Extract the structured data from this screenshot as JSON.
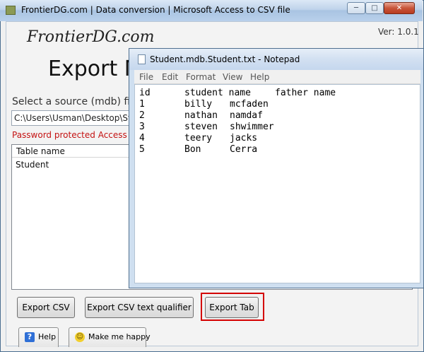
{
  "main_window": {
    "title": "FrontierDG.com | Data conversion | Microsoft Access to CSV file",
    "controls": {
      "minimize": "─",
      "maximize": "□",
      "close": "✕"
    }
  },
  "app": {
    "brand": "FrontierDG.com",
    "version": "Ver: 1.0.1",
    "heading": "Export M",
    "source_label": "Select a source (mdb) file",
    "source_path": "C:\\Users\\Usman\\Desktop\\St",
    "password_note": "Password protected Access da",
    "tables": {
      "header": "Table name",
      "rows": [
        "Student"
      ]
    },
    "buttons": {
      "export_csv": "Export CSV",
      "export_csv_qualifier": "Export CSV text qualifier",
      "export_tab": "Export Tab"
    },
    "tabs": {
      "help": "Help",
      "make_me_happy": "Make me happy"
    },
    "highlight_color": "#d40000"
  },
  "notepad": {
    "title": "Student.mdb.Student.txt - Notepad",
    "menu": [
      "File",
      "Edit",
      "Format",
      "View",
      "Help"
    ],
    "content": {
      "header": [
        "id",
        "student name",
        "father name"
      ],
      "rows": [
        [
          "1",
          "billy",
          "mcfaden"
        ],
        [
          "2",
          "nathan",
          "namdaf"
        ],
        [
          "3",
          "steven",
          "shwimmer"
        ],
        [
          "4",
          "teery",
          "jacks"
        ],
        [
          "5",
          "Bon",
          "Cerra"
        ]
      ]
    }
  }
}
